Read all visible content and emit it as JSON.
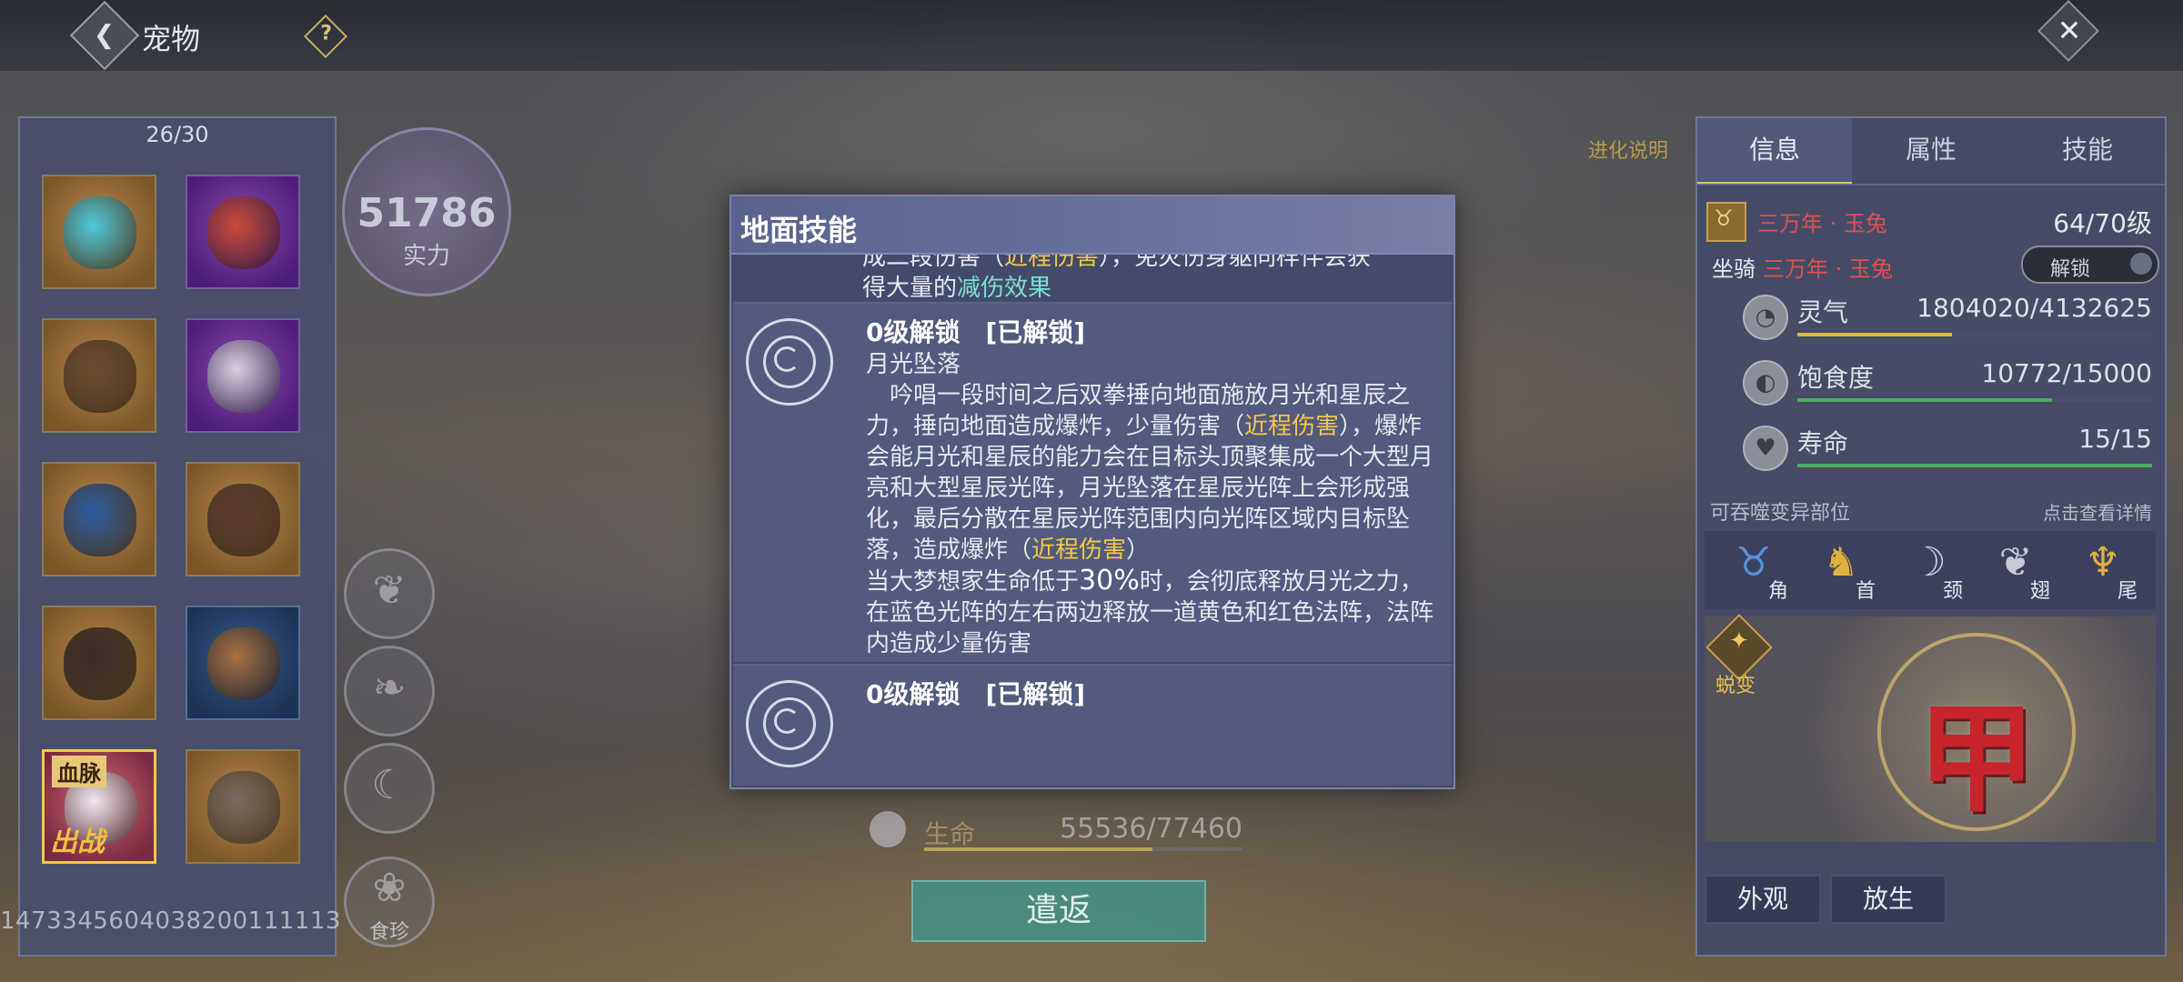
{
  "header": {
    "title": "宠物",
    "help_glyph": "?",
    "back_glyph": "❮",
    "close_glyph": "✕"
  },
  "pets": {
    "count": "26/30",
    "slots": [
      {
        "frame": "orange",
        "color": "#4ec8d8"
      },
      {
        "frame": "purple",
        "color": "#c84a3a"
      },
      {
        "frame": "orange",
        "color": "#6a4a30"
      },
      {
        "frame": "purple",
        "color": "#d8d0e0"
      },
      {
        "frame": "orange",
        "color": "#2a5aa0"
      },
      {
        "frame": "orange",
        "color": "#5a3a30"
      },
      {
        "frame": "orange",
        "color": "#3a2a2a"
      },
      {
        "frame": "blue",
        "color": "#a87040"
      },
      {
        "frame": "selected",
        "color": "#f0e8f0",
        "blood": "血脉",
        "battle": "出战"
      },
      {
        "frame": "orange",
        "color": "#7a6a60"
      }
    ],
    "id_text": "1473345604038200111113"
  },
  "power": {
    "value": "51786",
    "label": "实力"
  },
  "side_buttons": {
    "food_label": "食珍"
  },
  "evolve_hint": "进化说明",
  "info_panel": {
    "tabs": [
      "信息",
      "属性",
      "技能"
    ],
    "pet_badge_glyph": "♉",
    "pet_name": "三万年 · 玉兔",
    "level": "64/70级",
    "mount_label": "坐骑",
    "mount_name": "三万年 · 玉兔",
    "unlock_label": "解锁",
    "stats": [
      {
        "icon": "spirit-icon",
        "glyph": "◔",
        "name": "灵气",
        "value": "1804020/4132625",
        "fraction": 0.437,
        "color": "#d8b840"
      },
      {
        "icon": "stomach-icon",
        "glyph": "◐",
        "name": "饱食度",
        "value": "10772/15000",
        "fraction": 0.718,
        "color": "#48b060"
      },
      {
        "icon": "heart-icon",
        "glyph": "♥",
        "name": "寿命",
        "value": "15/15",
        "fraction": 1.0,
        "color": "#48b060"
      }
    ],
    "mutate_title": "可吞噬变异部位",
    "mutate_detail": "点击查看详情",
    "parts": [
      {
        "name": "角",
        "glyph": "♉",
        "tone": "blue"
      },
      {
        "name": "首",
        "glyph": "♞",
        "tone": "gold"
      },
      {
        "name": "颈",
        "glyph": "☽",
        "tone": ""
      },
      {
        "name": "翅",
        "glyph": "❦",
        "tone": ""
      },
      {
        "name": "尾",
        "glyph": "♆",
        "tone": "gold"
      }
    ],
    "transform_label": "蜕变",
    "transform_glyph": "✦",
    "rune_char": "甲",
    "buttons": [
      "外观",
      "放生"
    ]
  },
  "life": {
    "label": "生命",
    "value": "55536/77460",
    "fraction": 0.717
  },
  "dismiss_label": "遣返",
  "modal": {
    "title": "地面技能",
    "prev_fragment": {
      "line1_a": "成二段伤害（",
      "line1_hl": "近程伤害",
      "line1_b": "），免灾伤身躯同样伴会获",
      "line2_a": "得大量的",
      "line2_hl": "减伤效果"
    },
    "skill1": {
      "unlock": "0级解锁　[已解锁]",
      "name": "月光坠落",
      "p1": "　吟唱一段时间之后双拳捶向地面施放月光和星辰之力，捶向地面造成爆炸，少量伤害（",
      "p1_hl": "近程伤害",
      "p2": "），爆炸会能月光和星辰的能力会在目标头顶聚集成一个大型月亮和大型星辰光阵，月光坠落在星辰光阵上会形成强化，最后分散在星辰光阵范围内向光阵区域内目标坠落，造成爆炸（",
      "p2_hl": "近程伤害",
      "p3": "）",
      "p4_a": "当大梦想家生命低于",
      "p4_big": "30%",
      "p4_b": "时，会彻底释放月光之力，在蓝色光阵的左右两边释放一道黄色和红色法阵，法阵内造成少量伤害"
    },
    "skill2": {
      "unlock": "0级解锁　[已解锁]"
    }
  }
}
